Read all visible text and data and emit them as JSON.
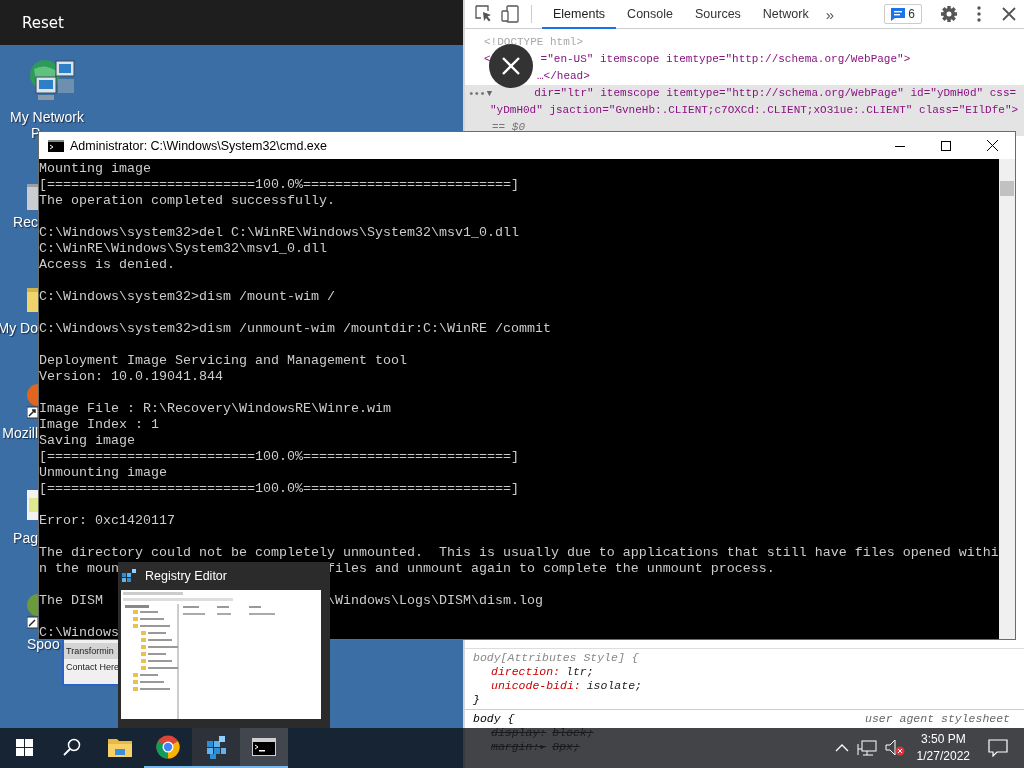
{
  "vm_bar": {
    "reset": "Reset"
  },
  "desktop": {
    "icons": [
      {
        "kind": "network",
        "label_lines": [
          "My Network",
          "P"
        ]
      },
      {
        "kind": "recycle",
        "label_lines": [
          "Rec"
        ]
      },
      {
        "kind": "folder",
        "label_lines": [
          "My Do"
        ]
      },
      {
        "kind": "browser",
        "label_lines": [
          "Mozill"
        ]
      },
      {
        "kind": "page",
        "label_lines": [
          "Pag"
        ]
      },
      {
        "kind": "app",
        "label_lines": [
          "Spoo"
        ]
      }
    ]
  },
  "popup_menu": {
    "items": [
      {
        "label": "Transformin",
        "selected": true
      },
      {
        "label": "Contact Here",
        "selected": false
      }
    ]
  },
  "cmd_window": {
    "title": "Administrator: C:\\Windows\\System32\\cmd.exe",
    "lines": [
      {
        "kind": "line",
        "text": "Mounting image"
      },
      {
        "kind": "line",
        "text": "[==========================100.0%==========================]"
      },
      {
        "kind": "line",
        "text": "The operation completed successfully."
      },
      {
        "kind": "blank"
      },
      {
        "kind": "line",
        "text": "C:\\Windows\\system32>del C:\\WinRE\\Windows\\System32\\msv1_0.dll"
      },
      {
        "kind": "line",
        "text": "C:\\WinRE\\Windows\\System32\\msv1_0.dll"
      },
      {
        "kind": "line",
        "text": "Access is denied."
      },
      {
        "kind": "blank"
      },
      {
        "kind": "line",
        "text": "C:\\Windows\\system32>dism /mount-wim /"
      },
      {
        "kind": "blank"
      },
      {
        "kind": "line",
        "text": "C:\\Windows\\system32>dism /unmount-wim /mountdir:C:\\WinRE /commit"
      },
      {
        "kind": "blank"
      },
      {
        "kind": "line",
        "text": "Deployment Image Servicing and Management tool"
      },
      {
        "kind": "line",
        "text": "Version: 10.0.19041.844"
      },
      {
        "kind": "blank"
      },
      {
        "kind": "line",
        "text": "Image File : R:\\Recovery\\WindowsRE\\Winre.wim"
      },
      {
        "kind": "line",
        "text": "Image Index : 1"
      },
      {
        "kind": "line",
        "text": "Saving image"
      },
      {
        "kind": "line",
        "text": "[==========================100.0%==========================]"
      },
      {
        "kind": "line",
        "text": "Unmounting image"
      },
      {
        "kind": "line",
        "text": "[==========================100.0%==========================]"
      },
      {
        "kind": "blank"
      },
      {
        "kind": "line",
        "text": "Error: 0xc1420117"
      },
      {
        "kind": "blank"
      },
      {
        "kind": "line",
        "text": "The directory could not be completely unmounted.  This is usually due to applications that still have files opened withi"
      },
      {
        "kind": "split",
        "text": "n the moun",
        "rest": "files and unmount again to complete the unmount process."
      },
      {
        "kind": "blank"
      },
      {
        "kind": "split",
        "text": "The DISM",
        "rest": "\\Windows\\Logs\\DISM\\dism.log"
      },
      {
        "kind": "blank"
      },
      {
        "kind": "line",
        "text": "C:\\Windows"
      }
    ]
  },
  "registry_preview": {
    "title": "Registry Editor"
  },
  "devtools": {
    "tabs": [
      {
        "label": "Elements",
        "selected": true
      },
      {
        "label": "Console",
        "selected": false
      },
      {
        "label": "Sources",
        "selected": false
      },
      {
        "label": "Network",
        "selected": false
      }
    ],
    "more": "»",
    "issues_count": "6",
    "dom_lines": [
      {
        "kind": "doctype",
        "text": "<!DOCTYPE html>",
        "selected": false
      },
      {
        "kind": "tag",
        "lead": "<",
        "text": "=\"en-US\" itemscope itemtype=\"http://schema.org/WebPage\">",
        "selected": false
      },
      {
        "kind": "tag",
        "text": "…</head>",
        "selected": false
      },
      {
        "kind": "tag",
        "dots": "•••",
        "toggle": "▼",
        "text": "dir=\"ltr\" itemscope itemtype=\"http://schema.org/WebPage\" id=\"yDmH0d\" css=",
        "selected": true
      },
      {
        "kind": "tag",
        "text": "\"yDmH0d\" jsaction=\"GvneHb:.CLIENT;c7OXCd:.CLIENT;xO31ue:.CLIENT\" class=\"EIlDfe\">",
        "selected": true
      },
      {
        "kind": "ref",
        "text": "== $0",
        "selected": true
      }
    ],
    "styles": [
      {
        "kind": "selector",
        "text": "body[Attributes Style] {"
      },
      {
        "kind": "prop",
        "name": "direction:",
        "value": "ltr;",
        "struck": false
      },
      {
        "kind": "prop",
        "name": "unicode-bidi:",
        "value": "isolate;",
        "struck": false
      },
      {
        "kind": "end",
        "text": "}"
      },
      {
        "kind": "rule",
        "text": "body {",
        "source": "user agent stylesheet"
      },
      {
        "kind": "prop",
        "name": "display:",
        "value": "block;",
        "struck": true
      },
      {
        "kind": "prop",
        "name": "margin:▸",
        "value": "8px;",
        "struck": true
      }
    ]
  },
  "taskbar": {
    "apps": [
      {
        "kind": "start"
      },
      {
        "kind": "search"
      },
      {
        "kind": "explorer",
        "running": false,
        "hovered": false,
        "active": false
      },
      {
        "kind": "chrome",
        "running": true,
        "hovered": false,
        "active": false
      },
      {
        "kind": "registry",
        "running": true,
        "hovered": true,
        "active": false
      },
      {
        "kind": "cmd",
        "running": true,
        "hovered": false,
        "active": true
      }
    ],
    "time": "3:50 PM",
    "date": "1/27/2022"
  }
}
